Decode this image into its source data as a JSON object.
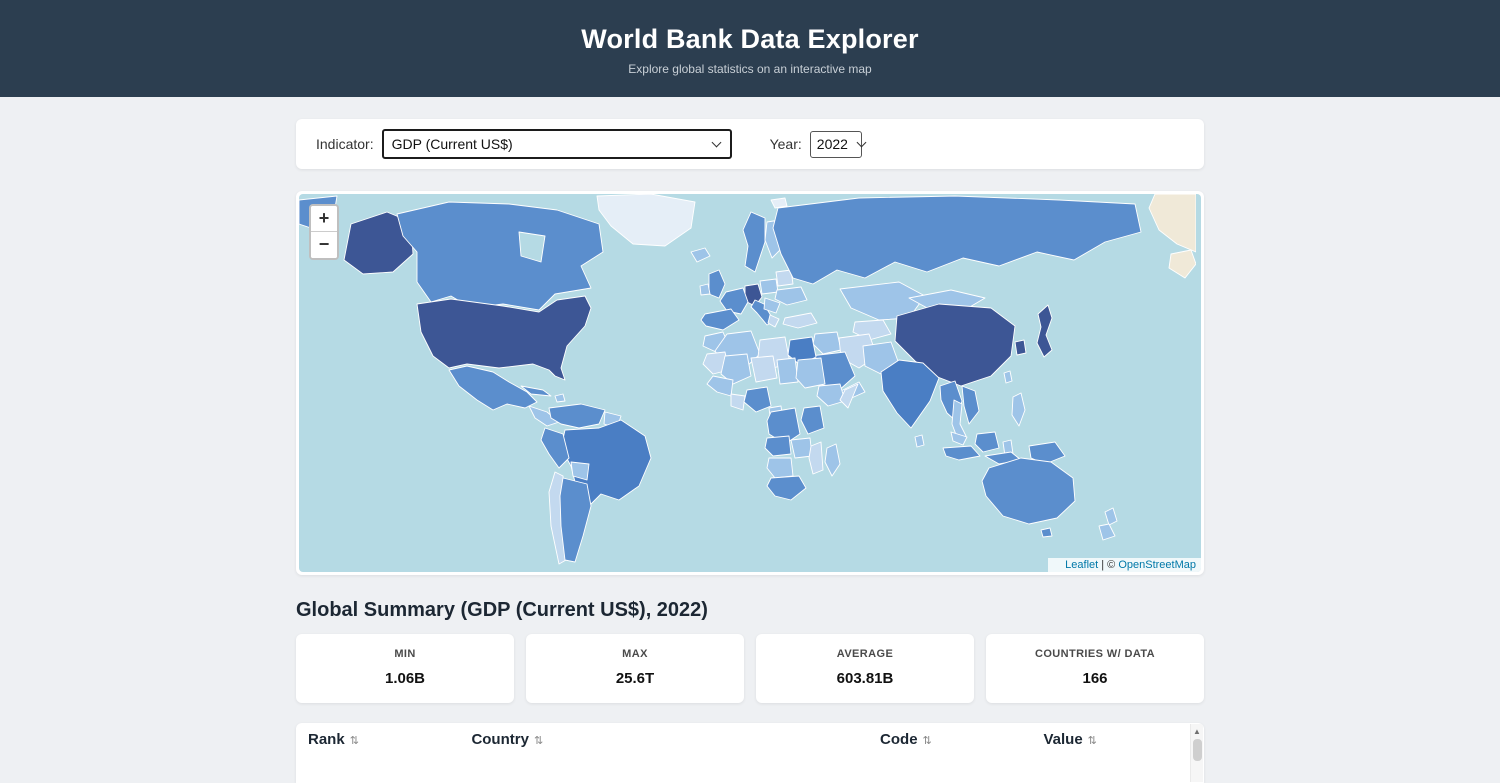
{
  "header": {
    "title": "World Bank Data Explorer",
    "subtitle": "Explore global statistics on an interactive map"
  },
  "controls": {
    "indicator_label": "Indicator:",
    "indicator_value": "GDP (Current US$)",
    "year_label": "Year:",
    "year_value": "2022"
  },
  "map": {
    "zoom_in_label": "+",
    "zoom_out_label": "−",
    "attribution": {
      "leaflet": "Leaflet",
      "separator": " | © ",
      "osm": "OpenStreetMap"
    }
  },
  "summary": {
    "heading": "Global Summary (GDP (Current US$), 2022)",
    "stats": [
      {
        "label": "MIN",
        "value": "1.06B"
      },
      {
        "label": "MAX",
        "value": "25.6T"
      },
      {
        "label": "AVERAGE",
        "value": "603.81B"
      },
      {
        "label": "COUNTRIES W/ DATA",
        "value": "166"
      }
    ]
  },
  "table": {
    "columns": [
      {
        "label": "Rank"
      },
      {
        "label": "Country"
      },
      {
        "label": "Code"
      },
      {
        "label": "Value"
      }
    ],
    "sort_icon": "⇅"
  },
  "colors": {
    "header_bg": "#2c3e50",
    "page_bg": "#eef0f3",
    "ocean": "#b5dae4",
    "link": "#0078a8",
    "choropleth_scale": [
      "#e5eef7",
      "#c3d9ef",
      "#9ec4e8",
      "#5b8ecd",
      "#4a7ec4",
      "#3d5695"
    ],
    "no_data": "#f0e9d8"
  }
}
